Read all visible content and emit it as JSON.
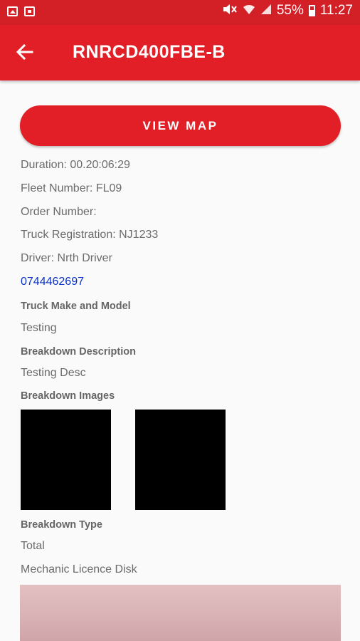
{
  "status_bar": {
    "battery_percent": "55%",
    "time": "11:27",
    "icons": [
      "image-icon",
      "message-icon",
      "mute-icon",
      "wifi-icon",
      "signal-icon",
      "battery-icon"
    ]
  },
  "app_bar": {
    "title": "RNRCD400FBE-B",
    "back_icon": "arrow-back-icon",
    "color": "#e21f26"
  },
  "view_map_label": "VIEW MAP",
  "details": {
    "duration": "Duration: 00.20:06:29",
    "fleet_number": "Fleet Number: FL09",
    "order_number": "Order Number:",
    "truck_registration": "Truck Registration: NJ1233",
    "driver": "Driver: Nrth Driver",
    "phone": "0744462697",
    "truck_make_model_label": "Truck Make and Model",
    "truck_make_model_value": "Testing",
    "breakdown_description_label": "Breakdown Description",
    "breakdown_description_value": "Testing Desc",
    "breakdown_images_label": "Breakdown Images",
    "breakdown_type_label": "Breakdown Type",
    "breakdown_type_value": "Total",
    "mechanic_licence_disk_label": "Mechanic Licence Disk"
  }
}
